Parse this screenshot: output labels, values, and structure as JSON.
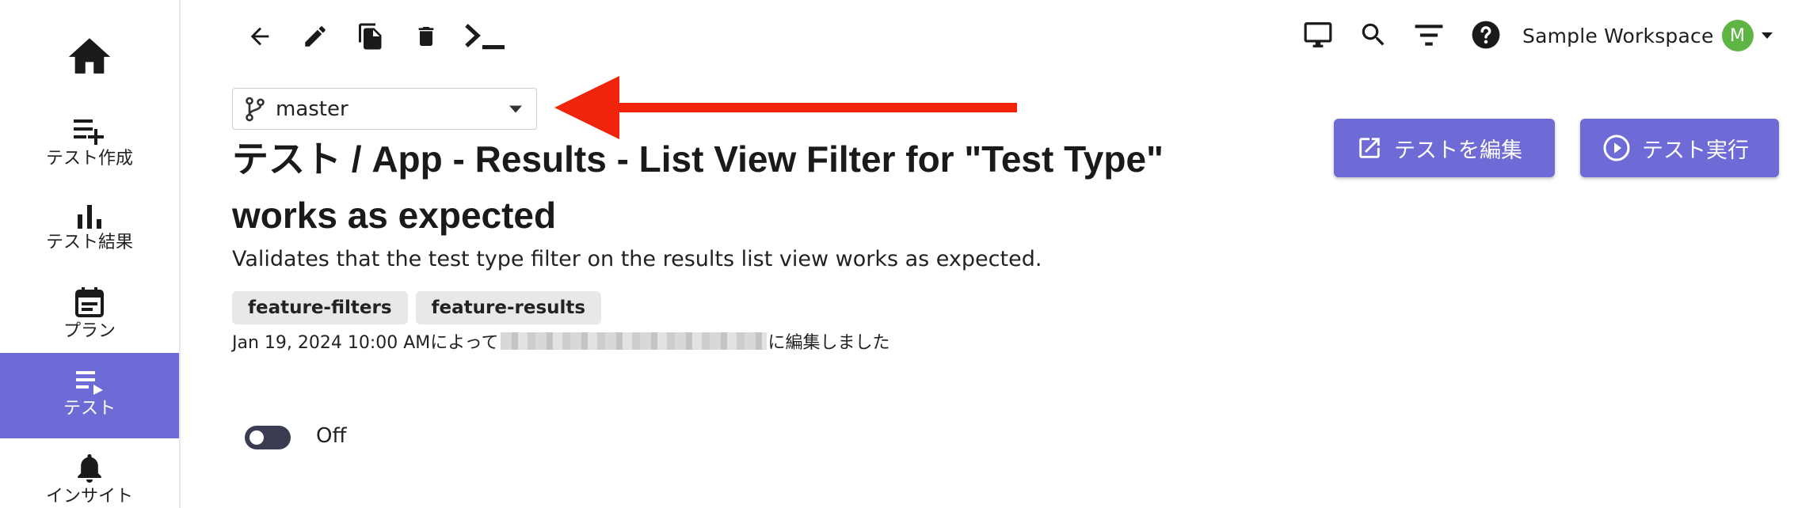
{
  "sidebar": {
    "items": [
      {
        "label": "テスト作成",
        "icon": "playlist-add-icon",
        "active": false
      },
      {
        "label": "テスト結果",
        "icon": "bar-chart-icon",
        "active": false
      },
      {
        "label": "プラン",
        "icon": "calendar-icon",
        "active": false
      },
      {
        "label": "テスト",
        "icon": "playlist-play-icon",
        "active": true
      },
      {
        "label": "インサイト",
        "icon": "bell-icon",
        "active": false
      }
    ]
  },
  "header": {
    "workspace_name": "Sample Workspace",
    "avatar_initial": "M"
  },
  "branch": {
    "value": "master"
  },
  "test": {
    "title": "テスト / App - Results - List View Filter for \"Test Type\" works as expected",
    "description": "Validates that the test type filter on the results list view works as expected.",
    "tags": [
      "feature-filters",
      "feature-results"
    ],
    "edited_prefix": "Jan 19, 2024 10:00 AMによって",
    "edited_suffix": "に編集しました"
  },
  "actions": {
    "edit_label": "テストを編集",
    "run_label": "テスト実行"
  },
  "toggle": {
    "label": "Off",
    "state": false
  },
  "colors": {
    "accent": "#6f6bd6",
    "annotation": "#f0230b",
    "avatar": "#5fb544",
    "toggle_track": "#3a3d52"
  }
}
